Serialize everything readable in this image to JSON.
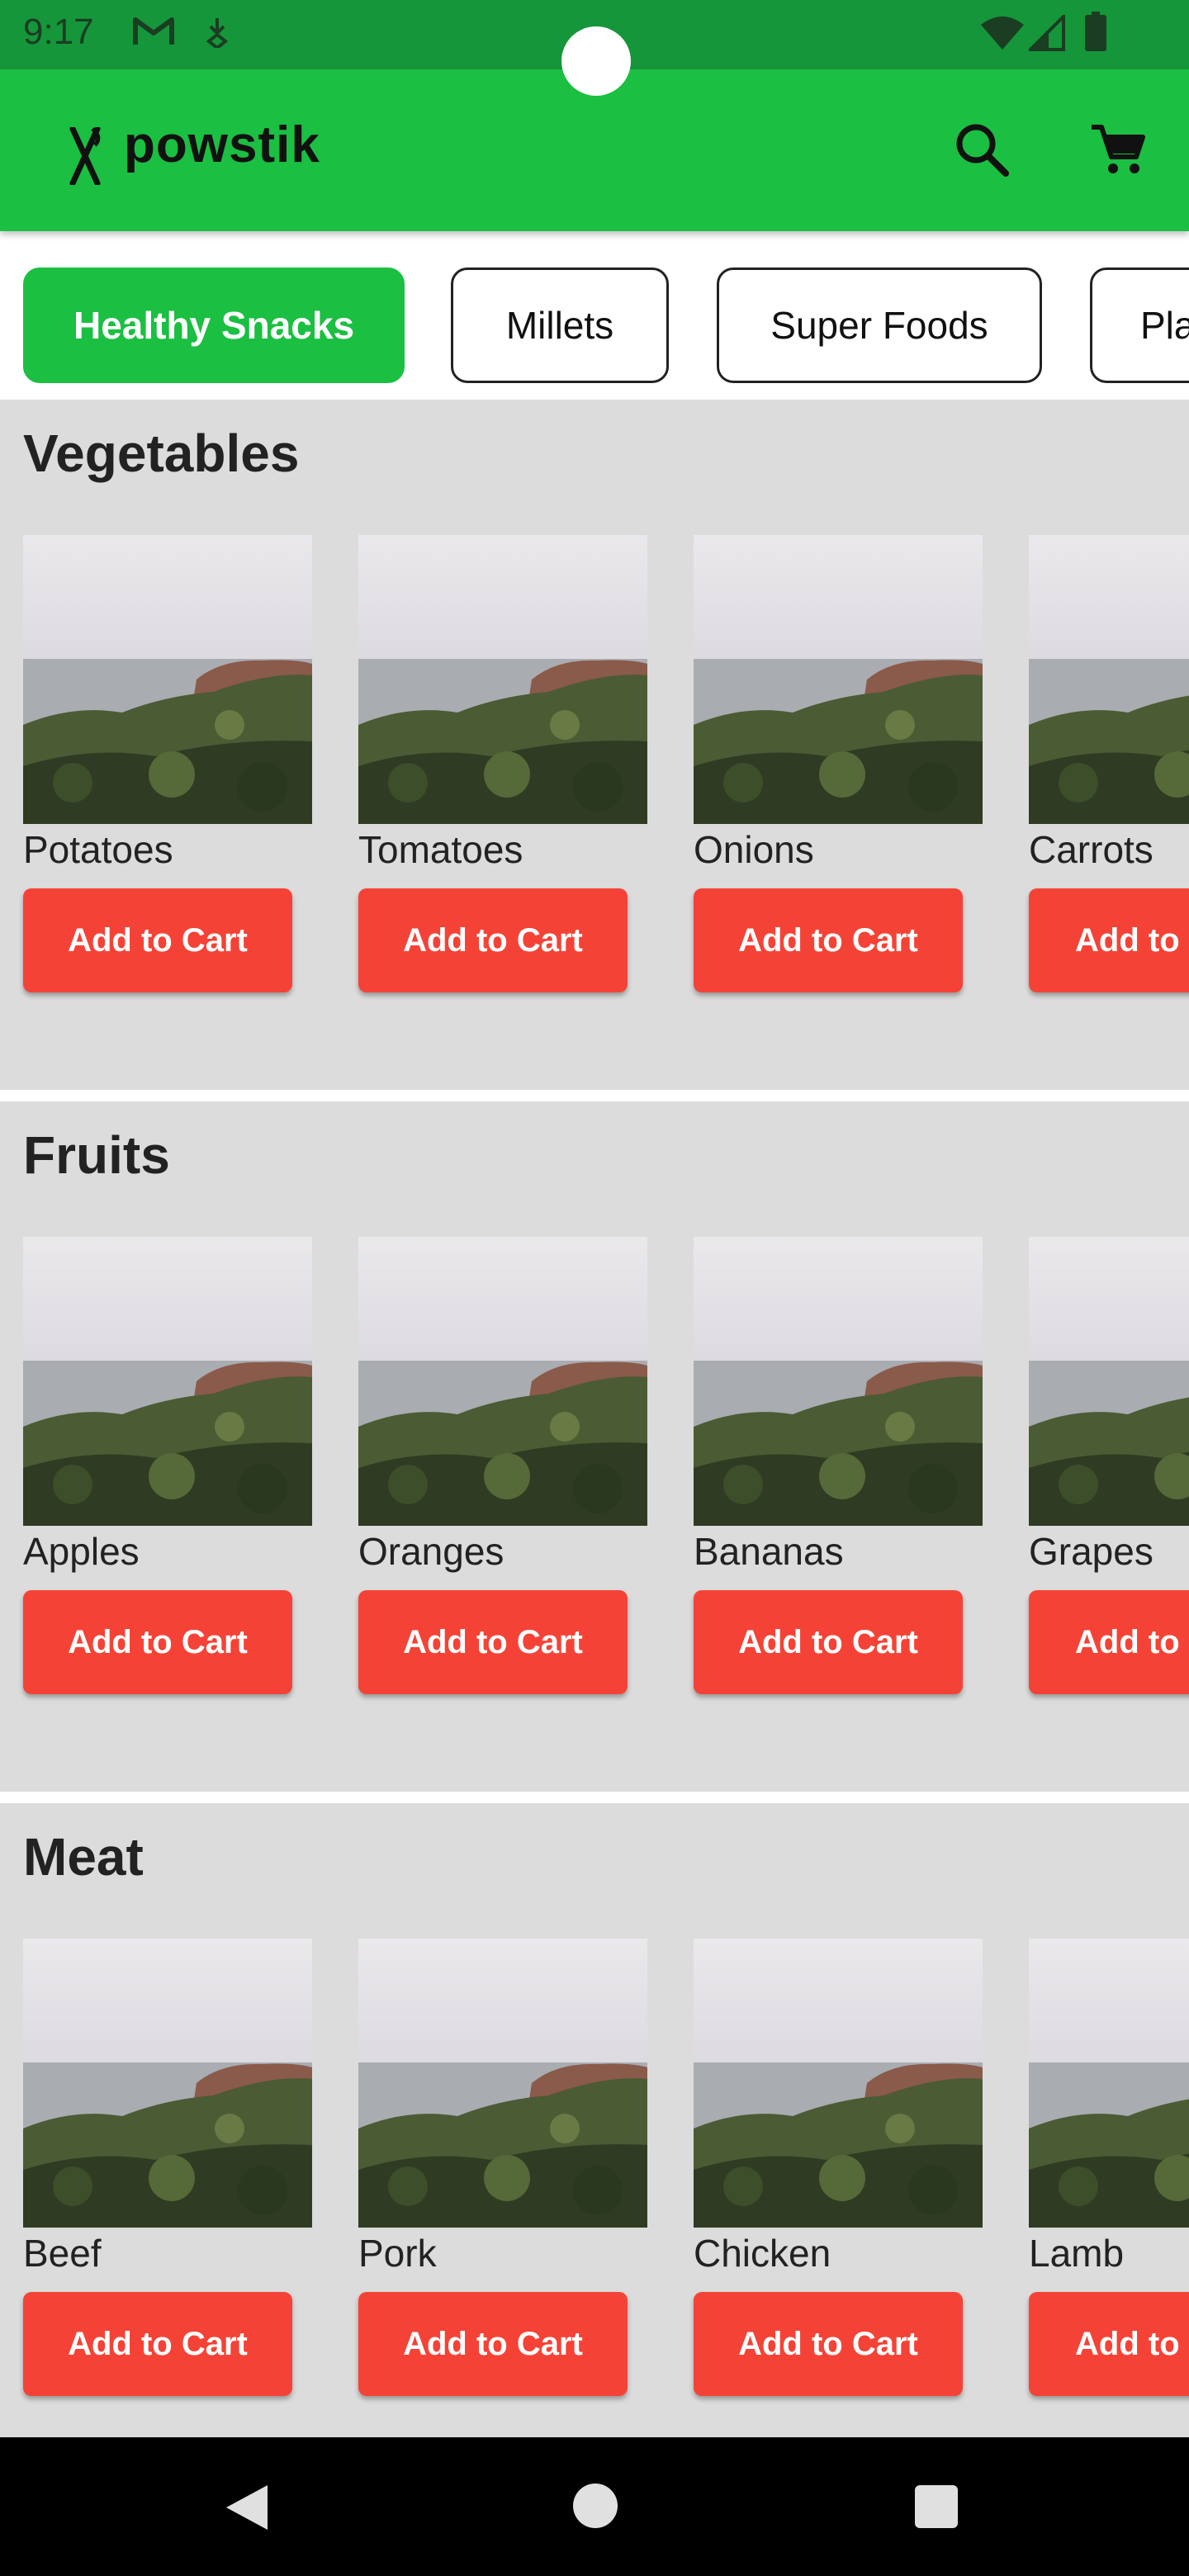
{
  "status_bar": {
    "time": "9:17",
    "icons": [
      "gmail-icon",
      "data-saver-icon",
      "wifi-icon",
      "signal-icon",
      "battery-icon"
    ]
  },
  "app_bar": {
    "logo_text": "powstik",
    "icons": [
      "fork-knife-logo-icon",
      "search-icon",
      "cart-icon"
    ],
    "color": "#1bbf42"
  },
  "categories": [
    {
      "label": "Healthy Snacks",
      "selected": true
    },
    {
      "label": "Millets",
      "selected": false
    },
    {
      "label": "Super Foods",
      "selected": false
    },
    {
      "label": "Pla",
      "selected": false
    }
  ],
  "sections": [
    {
      "title": "Vegetables",
      "products": [
        {
          "name": "Potatoes",
          "button": "Add to Cart"
        },
        {
          "name": "Tomatoes",
          "button": "Add to Cart"
        },
        {
          "name": "Onions",
          "button": "Add to Cart"
        },
        {
          "name": "Carrots",
          "button": "Add to C"
        }
      ]
    },
    {
      "title": "Fruits",
      "products": [
        {
          "name": "Apples",
          "button": "Add to Cart"
        },
        {
          "name": "Oranges",
          "button": "Add to Cart"
        },
        {
          "name": "Bananas",
          "button": "Add to Cart"
        },
        {
          "name": "Grapes",
          "button": "Add to C"
        }
      ]
    },
    {
      "title": "Meat",
      "products": [
        {
          "name": "Beef",
          "button": "Add to Cart"
        },
        {
          "name": "Pork",
          "button": "Add to Cart"
        },
        {
          "name": "Chicken",
          "button": "Add to Cart"
        },
        {
          "name": "Lamb",
          "button": "Add to C"
        }
      ]
    }
  ],
  "colors": {
    "primary": "#1bbf42",
    "status_bar": "#15963a",
    "button": "#f44336",
    "section_bg": "#dcdcdc"
  },
  "nav_bar": {
    "icons": [
      "back-icon",
      "home-icon",
      "recents-icon"
    ]
  }
}
